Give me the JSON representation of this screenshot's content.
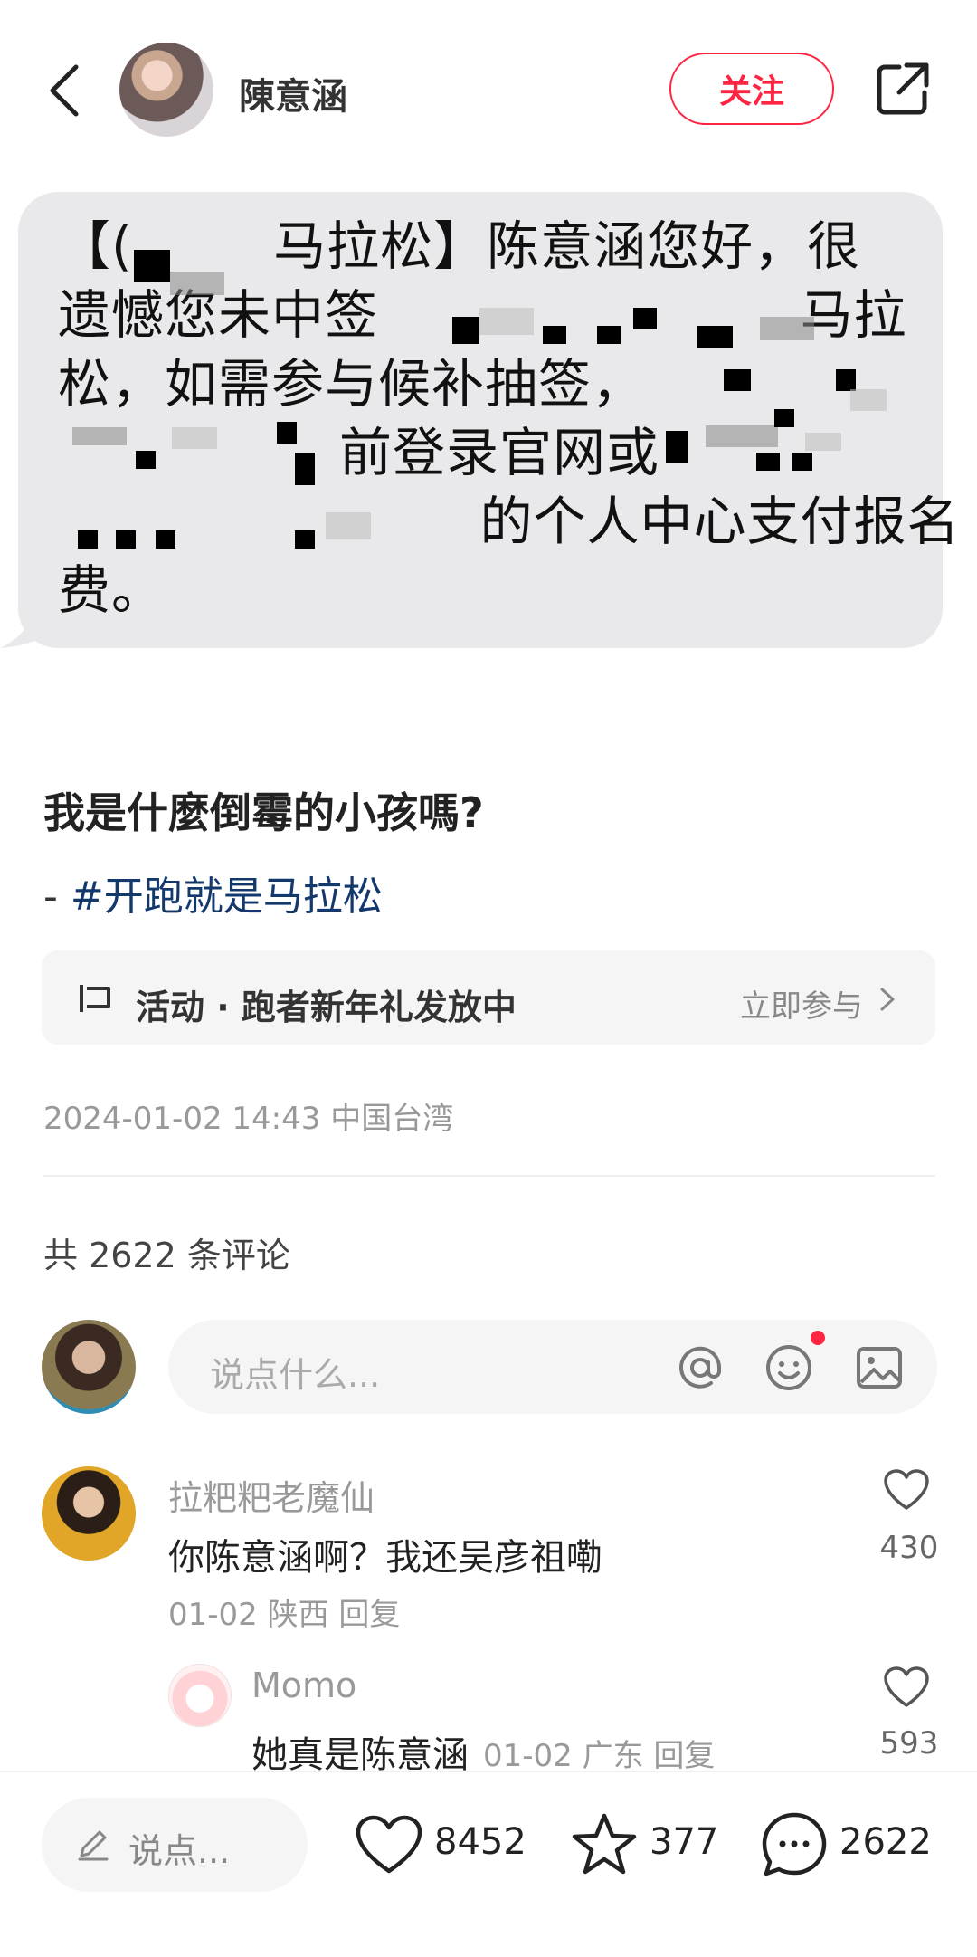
{
  "header": {
    "author_name": "陳意涵",
    "follow_label": "关注"
  },
  "message_image": {
    "lines": [
      "【(        马拉松】陈意涵您好，很",
      "遗憾您未中签                        马拉",
      "松，如需参与候补抽签，",
      "                前登录官网或",
      "                        的个人中心支付报名",
      "费。"
    ]
  },
  "post": {
    "title": "我是什麼倒霉的小孩嗎?",
    "tag_dash": "- ",
    "tag": "#开跑就是马拉松",
    "activity_text": "活动 · 跑者新年礼发放中",
    "activity_join": "立即参与",
    "meta": "2024-01-02 14:43 中国台湾"
  },
  "comments_section": {
    "count_text": "共 2622 条评论",
    "input_placeholder": "说点什么...",
    "comments": [
      {
        "user": "拉粑粑老魔仙",
        "text": "你陈意涵啊？我还吴彦祖嘞",
        "meta": "01-02 陕西 回复",
        "likes": "430"
      },
      {
        "user": "Momo",
        "text": "她真是陈意涵",
        "meta": "01-02 广东 回复",
        "likes": "593"
      }
    ]
  },
  "bottom_bar": {
    "input_placeholder": "说点...",
    "likes": "8452",
    "stars": "377",
    "comments": "2622"
  },
  "colors": {
    "accent": "#ff2442",
    "tag_blue": "#13386c"
  }
}
